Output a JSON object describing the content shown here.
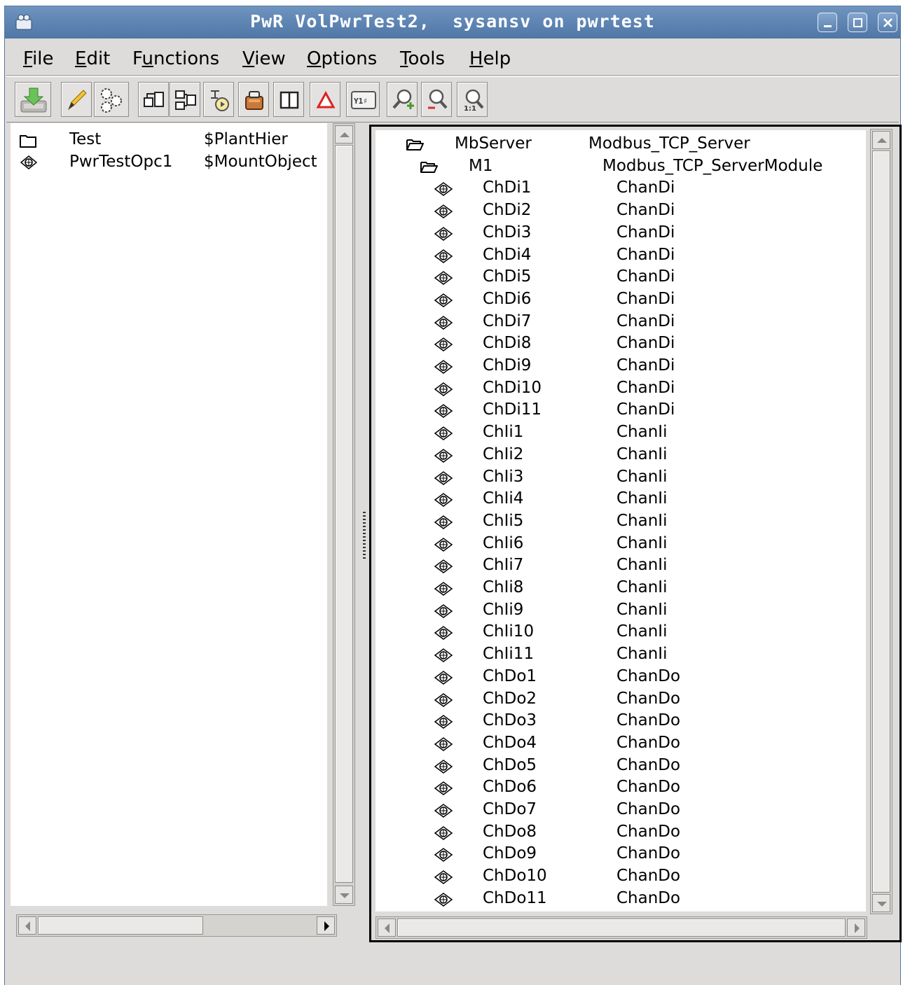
{
  "window": {
    "title": "PwR VolPwrTest2,  sysansv on pwrtest"
  },
  "menubar": {
    "items": [
      {
        "pre": "",
        "u": "F",
        "post": "ile"
      },
      {
        "pre": "",
        "u": "E",
        "post": "dit"
      },
      {
        "pre": "F",
        "u": "u",
        "post": "nctions"
      },
      {
        "pre": "",
        "u": "V",
        "post": "iew"
      },
      {
        "pre": "",
        "u": "O",
        "post": "ptions"
      },
      {
        "pre": "",
        "u": "T",
        "post": "ools"
      },
      {
        "pre": "",
        "u": "H",
        "post": "elp"
      }
    ]
  },
  "toolbar": {
    "icons": [
      "save-icon",
      "edit-icon",
      "configure-icon",
      "open-object-icon",
      "open-plc-icon",
      "trace-icon",
      "crossref-icon",
      "split-view-icon",
      "alarm-icon",
      "build-icon",
      "zoom-in-icon",
      "zoom-out-icon",
      "zoom-reset-icon"
    ]
  },
  "left_pane": {
    "rows": [
      {
        "icon": "folder-icon",
        "name": "Test",
        "class": "$PlantHier"
      },
      {
        "icon": "object-icon",
        "name": "PwrTestOpc1",
        "class": "$MountObject"
      }
    ]
  },
  "right_pane": {
    "rows": [
      {
        "icon": "open-folder-icon",
        "level": 0,
        "name": "MbServer",
        "class": "Modbus_TCP_Server"
      },
      {
        "icon": "open-folder-icon",
        "level": 1,
        "name": "M1",
        "class": "Modbus_TCP_ServerModule"
      },
      {
        "icon": "object-icon",
        "level": 2,
        "name": "ChDi1",
        "class": "ChanDi"
      },
      {
        "icon": "object-icon",
        "level": 2,
        "name": "ChDi2",
        "class": "ChanDi"
      },
      {
        "icon": "object-icon",
        "level": 2,
        "name": "ChDi3",
        "class": "ChanDi"
      },
      {
        "icon": "object-icon",
        "level": 2,
        "name": "ChDi4",
        "class": "ChanDi"
      },
      {
        "icon": "object-icon",
        "level": 2,
        "name": "ChDi5",
        "class": "ChanDi"
      },
      {
        "icon": "object-icon",
        "level": 2,
        "name": "ChDi6",
        "class": "ChanDi"
      },
      {
        "icon": "object-icon",
        "level": 2,
        "name": "ChDi7",
        "class": "ChanDi"
      },
      {
        "icon": "object-icon",
        "level": 2,
        "name": "ChDi8",
        "class": "ChanDi"
      },
      {
        "icon": "object-icon",
        "level": 2,
        "name": "ChDi9",
        "class": "ChanDi"
      },
      {
        "icon": "object-icon",
        "level": 2,
        "name": "ChDi10",
        "class": "ChanDi"
      },
      {
        "icon": "object-icon",
        "level": 2,
        "name": "ChDi11",
        "class": "ChanDi"
      },
      {
        "icon": "object-icon",
        "level": 2,
        "name": "ChIi1",
        "class": "ChanIi"
      },
      {
        "icon": "object-icon",
        "level": 2,
        "name": "ChIi2",
        "class": "ChanIi"
      },
      {
        "icon": "object-icon",
        "level": 2,
        "name": "ChIi3",
        "class": "ChanIi"
      },
      {
        "icon": "object-icon",
        "level": 2,
        "name": "ChIi4",
        "class": "ChanIi"
      },
      {
        "icon": "object-icon",
        "level": 2,
        "name": "ChIi5",
        "class": "ChanIi"
      },
      {
        "icon": "object-icon",
        "level": 2,
        "name": "ChIi6",
        "class": "ChanIi"
      },
      {
        "icon": "object-icon",
        "level": 2,
        "name": "ChIi7",
        "class": "ChanIi"
      },
      {
        "icon": "object-icon",
        "level": 2,
        "name": "ChIi8",
        "class": "ChanIi"
      },
      {
        "icon": "object-icon",
        "level": 2,
        "name": "ChIi9",
        "class": "ChanIi"
      },
      {
        "icon": "object-icon",
        "level": 2,
        "name": "ChIi10",
        "class": "ChanIi"
      },
      {
        "icon": "object-icon",
        "level": 2,
        "name": "ChIi11",
        "class": "ChanIi"
      },
      {
        "icon": "object-icon",
        "level": 2,
        "name": "ChDo1",
        "class": "ChanDo"
      },
      {
        "icon": "object-icon",
        "level": 2,
        "name": "ChDo2",
        "class": "ChanDo"
      },
      {
        "icon": "object-icon",
        "level": 2,
        "name": "ChDo3",
        "class": "ChanDo"
      },
      {
        "icon": "object-icon",
        "level": 2,
        "name": "ChDo4",
        "class": "ChanDo"
      },
      {
        "icon": "object-icon",
        "level": 2,
        "name": "ChDo5",
        "class": "ChanDo"
      },
      {
        "icon": "object-icon",
        "level": 2,
        "name": "ChDo6",
        "class": "ChanDo"
      },
      {
        "icon": "object-icon",
        "level": 2,
        "name": "ChDo7",
        "class": "ChanDo"
      },
      {
        "icon": "object-icon",
        "level": 2,
        "name": "ChDo8",
        "class": "ChanDo"
      },
      {
        "icon": "object-icon",
        "level": 2,
        "name": "ChDo9",
        "class": "ChanDo"
      },
      {
        "icon": "object-icon",
        "level": 2,
        "name": "ChDo10",
        "class": "ChanDo"
      },
      {
        "icon": "object-icon",
        "level": 2,
        "name": "ChDo11",
        "class": "ChanDo"
      }
    ]
  }
}
